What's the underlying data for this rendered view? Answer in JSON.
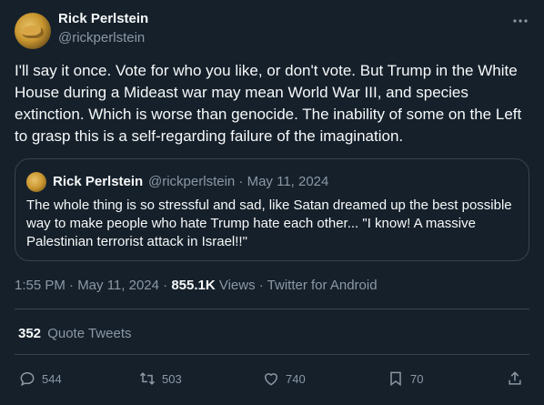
{
  "author": {
    "name": "Rick Perlstein",
    "handle": "@rickperlstein"
  },
  "more_icon": "more-horizontal-icon",
  "tweet_text": "I'll say it once. Vote for who you like, or don't vote. But Trump in the White House during a Mideast war may mean World War III, and species extinction. Which is worse than genocide. The inability of some on the Left to grasp this is a self-regarding failure of the imagination.",
  "quoted": {
    "name": "Rick Perlstein",
    "meta": "@rickperlstein · May 11, 2024",
    "text": "The whole thing is so stressful and sad, like Satan dreamed up the best possible way to make people who hate Trump hate each other... \"I know! A massive Palestinian terrorist attack in Israel!!\""
  },
  "meta": {
    "time_date": "1:55 PM · May 11, 2024 · ",
    "views_count": "855.1K",
    "views_label": " Views · ",
    "source": "Twitter for Android"
  },
  "quote_tweets": {
    "count": "352",
    "label": "Quote Tweets"
  },
  "actions": {
    "replies": "544",
    "retweets": "503",
    "likes": "740",
    "bookmarks": "70"
  },
  "colors": {
    "background": "#15202b",
    "text": "#f7f9f9",
    "secondary": "#8b98a5",
    "border": "#38444d"
  }
}
